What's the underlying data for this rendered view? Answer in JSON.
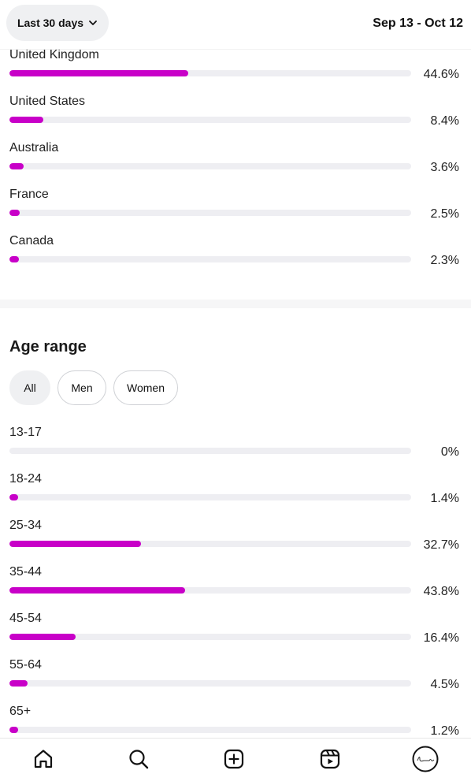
{
  "header": {
    "range_label": "Last 30 days",
    "date_range": "Sep 13 - Oct 12"
  },
  "countries": [
    {
      "label": "United Kingdom",
      "value": 44.6,
      "display": "44.6%"
    },
    {
      "label": "United States",
      "value": 8.4,
      "display": "8.4%"
    },
    {
      "label": "Australia",
      "value": 3.6,
      "display": "3.6%"
    },
    {
      "label": "France",
      "value": 2.5,
      "display": "2.5%"
    },
    {
      "label": "Canada",
      "value": 2.3,
      "display": "2.3%"
    }
  ],
  "age_section": {
    "title": "Age range",
    "filters": [
      {
        "label": "All",
        "active": true
      },
      {
        "label": "Men",
        "active": false
      },
      {
        "label": "Women",
        "active": false
      }
    ],
    "ranges": [
      {
        "label": "13-17",
        "value": 0,
        "display": "0%"
      },
      {
        "label": "18-24",
        "value": 1.4,
        "display": "1.4%"
      },
      {
        "label": "25-34",
        "value": 32.7,
        "display": "32.7%"
      },
      {
        "label": "35-44",
        "value": 43.8,
        "display": "43.8%"
      },
      {
        "label": "45-54",
        "value": 16.4,
        "display": "16.4%"
      },
      {
        "label": "55-64",
        "value": 4.5,
        "display": "4.5%"
      },
      {
        "label": "65+",
        "value": 1.2,
        "display": "1.2%"
      }
    ]
  },
  "bottom_nav": [
    {
      "icon": "home-icon"
    },
    {
      "icon": "search-icon"
    },
    {
      "icon": "create-icon"
    },
    {
      "icon": "reels-icon"
    },
    {
      "icon": "profile-avatar"
    }
  ],
  "colors": {
    "bar_fill": "#c800c8",
    "bar_track": "#eeeef2",
    "chip_active": "#eff0f2"
  }
}
